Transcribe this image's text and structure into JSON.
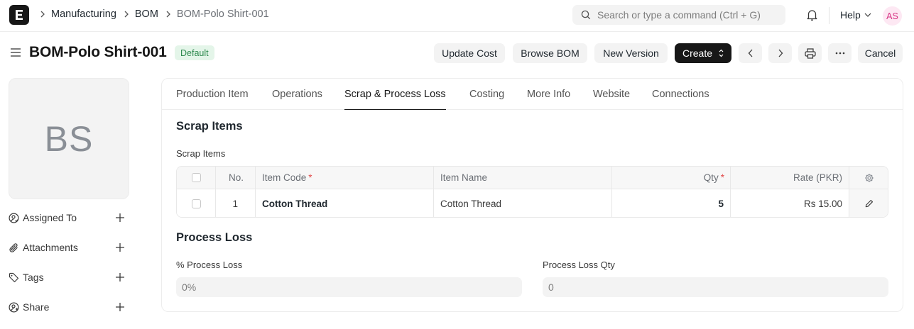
{
  "navbar": {
    "logo_letter": "E",
    "breadcrumbs": [
      "Manufacturing",
      "BOM",
      "BOM-Polo Shirt-001"
    ],
    "search_placeholder": "Search or type a command (Ctrl + G)",
    "help_label": "Help",
    "user_initials": "AS"
  },
  "page": {
    "title": "BOM-Polo Shirt-001",
    "status": "Default",
    "actions": {
      "update_cost": "Update Cost",
      "browse_bom": "Browse BOM",
      "new_version": "New Version",
      "create": "Create",
      "cancel": "Cancel"
    }
  },
  "sidebar": {
    "avatar_initials": "BS",
    "items": [
      {
        "label": "Assigned To",
        "icon": "assign-icon"
      },
      {
        "label": "Attachments",
        "icon": "paperclip-icon"
      },
      {
        "label": "Tags",
        "icon": "tag-icon"
      },
      {
        "label": "Share",
        "icon": "share-icon"
      }
    ]
  },
  "tabs": [
    "Production Item",
    "Operations",
    "Scrap & Process Loss",
    "Costing",
    "More Info",
    "Website",
    "Connections"
  ],
  "active_tab": "Scrap & Process Loss",
  "scrap_section": {
    "title": "Scrap Items",
    "table_label": "Scrap Items",
    "columns": {
      "no": "No.",
      "item_code": "Item Code",
      "item_name": "Item Name",
      "qty": "Qty",
      "rate": "Rate (PKR)"
    },
    "rows": [
      {
        "no": "1",
        "item_code": "Cotton Thread",
        "item_name": "Cotton Thread",
        "qty": "5",
        "rate": "Rs 15.00"
      }
    ]
  },
  "process_loss": {
    "title": "Process Loss",
    "percent_label": "% Process Loss",
    "percent_value": "0%",
    "qty_label": "Process Loss Qty",
    "qty_value": "0"
  }
}
